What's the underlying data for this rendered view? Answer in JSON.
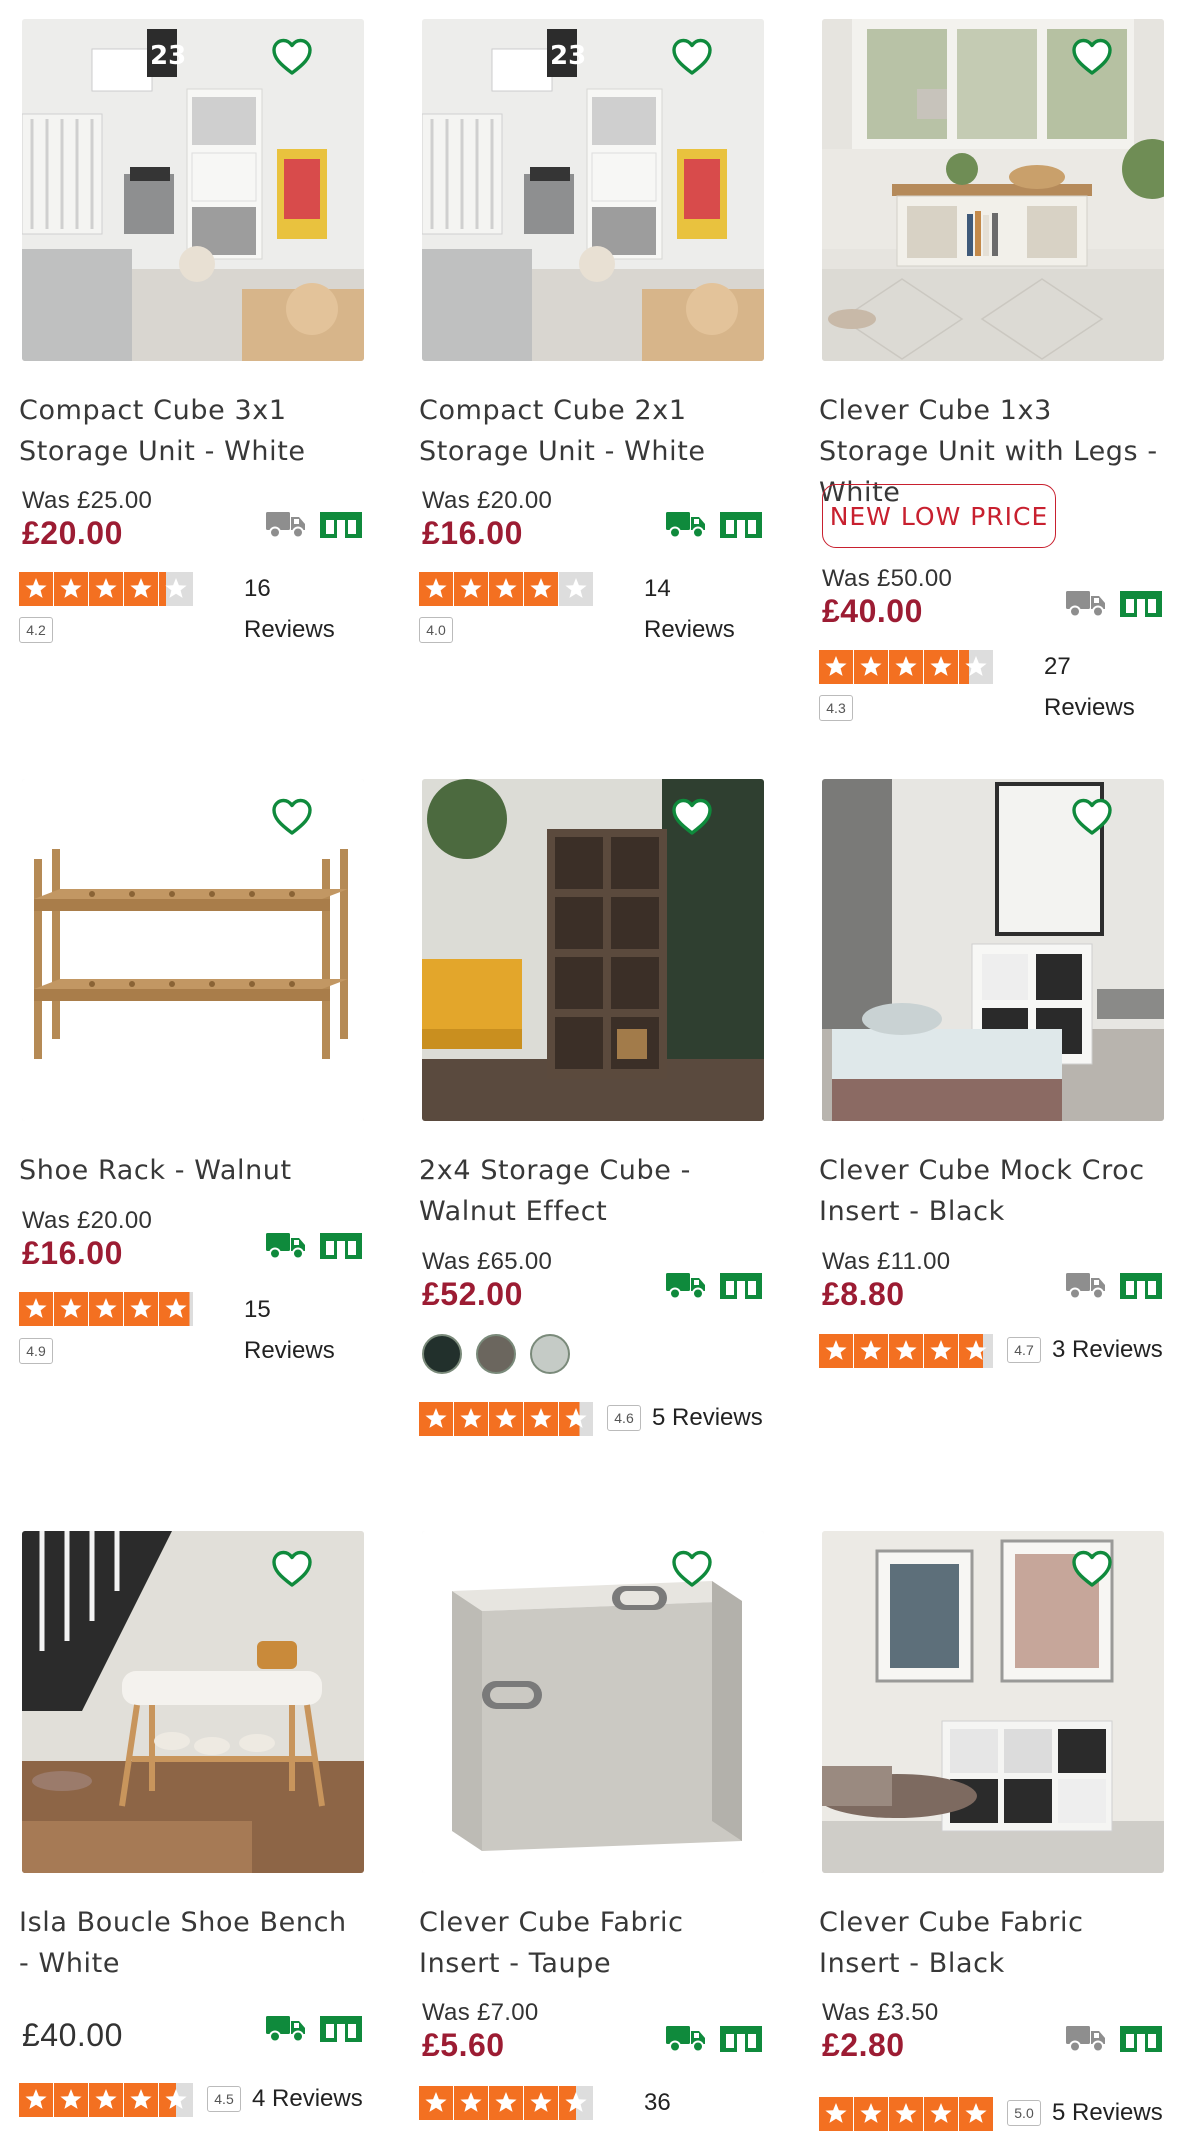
{
  "colors": {
    "accent_green": "#0f8a3c",
    "price_red": "#9c1c33",
    "badge_red": "#c8202f",
    "star_orange": "#f37021",
    "delivery_unavailable_grey": "#8e8e8e"
  },
  "products": [
    {
      "name": "Compact Cube 3x1 Storage Unit - White",
      "was": "Was £25.00",
      "price": "£20.00",
      "badge": "",
      "rating": "4.2",
      "stars_fill": 0.84,
      "reviews": "16 Reviews",
      "delivery_available": false,
      "collect_available": true,
      "image": "nursery-storage-photo",
      "swatches": []
    },
    {
      "name": "Compact Cube 2x1 Storage Unit - White",
      "was": "Was £20.00",
      "price": "£16.00",
      "badge": "",
      "rating": "4.0",
      "stars_fill": 0.8,
      "reviews": "14 Reviews",
      "delivery_available": true,
      "collect_available": true,
      "image": "nursery-storage-photo",
      "swatches": []
    },
    {
      "name": "Clever Cube 1x3 Storage Unit with Legs - White",
      "was": "Was £50.00",
      "price": "£40.00",
      "badge": "NEW LOW PRICE",
      "rating": "4.3",
      "stars_fill": 0.86,
      "reviews": "27 Reviews",
      "delivery_available": false,
      "collect_available": true,
      "image": "window-bench-photo",
      "swatches": []
    },
    {
      "name": "Shoe Rack - Walnut",
      "was": "Was £20.00",
      "price": "£16.00",
      "badge": "",
      "rating": "4.9",
      "stars_fill": 0.98,
      "reviews": "15 Reviews",
      "delivery_available": true,
      "collect_available": true,
      "image": "shoe-rack-photo",
      "swatches": []
    },
    {
      "name": "2x4 Storage Cube - Walnut Effect",
      "was": "Was £65.00",
      "price": "£52.00",
      "badge": "",
      "rating": "4.6",
      "stars_fill": 0.92,
      "reviews": "5 Reviews",
      "delivery_available": true,
      "collect_available": true,
      "image": "walnut-cube-photo",
      "swatches": [
        "#22302c",
        "#6b665e",
        "#c5cbc6"
      ]
    },
    {
      "name": "Clever Cube Mock Croc Insert - Black",
      "was": "Was £11.00",
      "price": "£8.80",
      "badge": "",
      "rating": "4.7",
      "stars_fill": 0.94,
      "reviews": "3 Reviews",
      "delivery_available": false,
      "collect_available": true,
      "image": "living-room-cube-photo",
      "swatches": []
    },
    {
      "name": "Isla Boucle Shoe Bench - White",
      "was": "",
      "price": "£40.00",
      "badge": "",
      "rating": "4.5",
      "stars_fill": 0.9,
      "reviews": "4 Reviews",
      "delivery_available": true,
      "collect_available": true,
      "image": "shoe-bench-photo",
      "swatches": []
    },
    {
      "name": "Clever Cube Fabric Insert - Taupe",
      "was": "Was £7.00",
      "price": "£5.60",
      "badge": "",
      "rating": "",
      "stars_fill": 0.9,
      "reviews": "36",
      "delivery_available": true,
      "collect_available": true,
      "image": "fabric-box-photo",
      "swatches": []
    },
    {
      "name": "Clever Cube Fabric Insert - Black",
      "was": "Was £3.50",
      "price": "£2.80",
      "badge": "",
      "rating": "5.0",
      "stars_fill": 1.0,
      "reviews": "5 Reviews",
      "delivery_available": false,
      "collect_available": true,
      "image": "lounge-cube-photo",
      "swatches": []
    }
  ]
}
